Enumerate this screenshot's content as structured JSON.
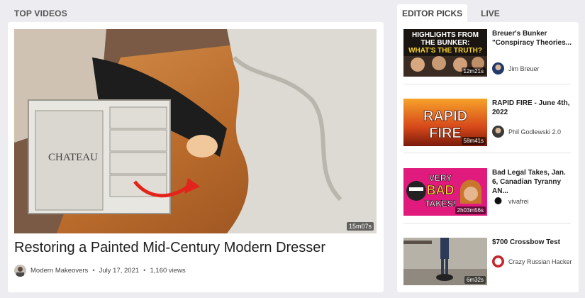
{
  "sections": {
    "top_videos": "TOP VIDEOS"
  },
  "tabs": [
    {
      "label": "EDITOR PICKS"
    },
    {
      "label": "LIVE"
    }
  ],
  "featured": {
    "duration": "15m07s",
    "title": "Restoring a Painted Mid-Century Modern Dresser",
    "channel": "Modern Makeovers",
    "date": "July 17, 2021",
    "views": "1,160 views",
    "thumb_text": "CHATEAU"
  },
  "picks": [
    {
      "title": "Breuer's Bunker \"Conspiracy Theories...",
      "channel": "Jim Breuer",
      "duration": "12m21s",
      "thumb_text": [
        "HIGHLIGHTS FROM",
        "THE BUNKER:",
        "WHAT'S THE TRUTH?"
      ]
    },
    {
      "title": "RAPID FIRE - June 4th, 2022",
      "channel": "Phil Godlewski 2.0",
      "duration": "58m41s",
      "thumb_text": [
        "RAPID",
        "FIRE"
      ]
    },
    {
      "title": "Bad Legal Takes, Jan. 6, Canadian Tyranny AN...",
      "channel": "vivafrei",
      "duration": "2h03m56s",
      "thumb_text": [
        "VERY",
        "BAD",
        "TAKES!"
      ]
    },
    {
      "title": "$700 Crossbow Test",
      "channel": "Crazy Russian Hacker",
      "duration": "6m32s"
    }
  ]
}
